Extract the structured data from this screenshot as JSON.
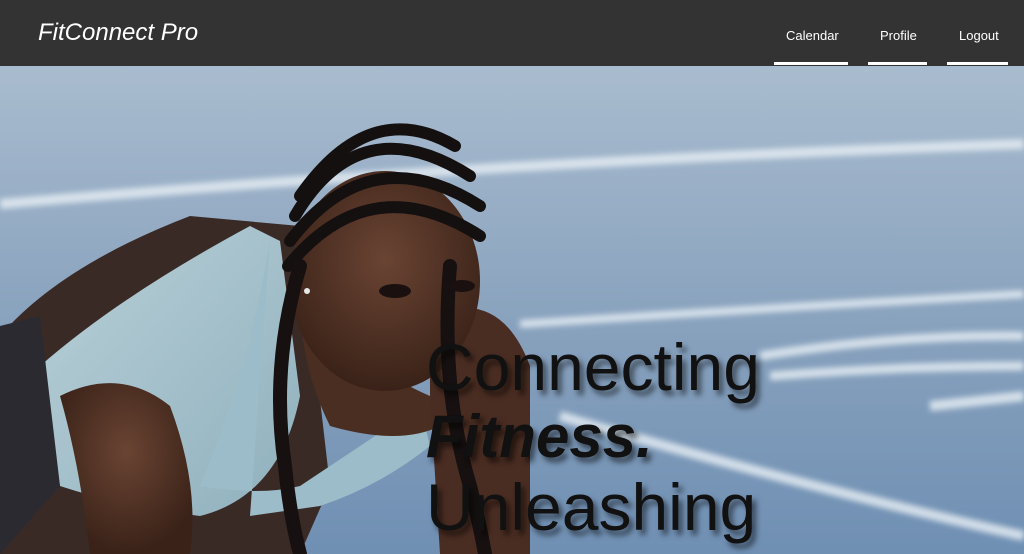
{
  "navbar": {
    "brand": "FitConnect Pro",
    "links": [
      {
        "label": "Calendar"
      },
      {
        "label": "Profile"
      },
      {
        "label": "Logout"
      }
    ]
  },
  "hero": {
    "line1": "Connecting",
    "line2": "Fitness.",
    "line3": "Unleashing",
    "image_description_icon": "athlete-photo"
  },
  "colors": {
    "navbar_bg": "#333333",
    "nav_text": "#ffffff",
    "track_blue": "#7f9bb8",
    "hero_text": "#111111"
  }
}
